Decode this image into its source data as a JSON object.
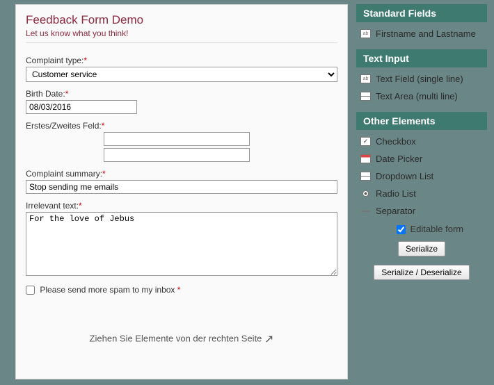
{
  "form": {
    "title": "Feedback Form Demo",
    "subtitle": "Let us know what you think!",
    "complaint_type": {
      "label": "Complaint type:",
      "value": "Customer service"
    },
    "birth_date": {
      "label": "Birth Date:",
      "value": "08/03/2016"
    },
    "double_field": {
      "label": "Erstes/Zweites Feld:",
      "value1": "",
      "value2": ""
    },
    "summary": {
      "label": "Complaint summary:",
      "value": "Stop sending me emails"
    },
    "irrelevant": {
      "label": "Irrelevant text:",
      "value": "For the love of Jebus"
    },
    "spam_check": {
      "label": "Please send more spam to my inbox",
      "checked": false
    },
    "drop_hint": "Ziehen Sie Elemente von der rechten Seite"
  },
  "sidebar": {
    "standard_header": "Standard Fields",
    "standard_items": [
      {
        "label": "Firstname and Lastname",
        "icon": "textfield-icon"
      }
    ],
    "textinput_header": "Text Input",
    "textinput_items": [
      {
        "label": "Text Field (single line)",
        "icon": "textfield-icon"
      },
      {
        "label": "Text Area (multi line)",
        "icon": "textarea-icon"
      }
    ],
    "other_header": "Other Elements",
    "other_items": [
      {
        "label": "Checkbox",
        "icon": "checkbox-icon"
      },
      {
        "label": "Date Picker",
        "icon": "datepicker-icon"
      },
      {
        "label": "Dropdown List",
        "icon": "dropdown-icon"
      },
      {
        "label": "Radio List",
        "icon": "radio-icon"
      },
      {
        "label": "Separator",
        "icon": "separator-icon"
      }
    ],
    "editable_label": "Editable form",
    "editable_checked": true,
    "serialize_btn": "Serialize",
    "serialize_deserialize_btn": "Serialize / Deserialize"
  }
}
